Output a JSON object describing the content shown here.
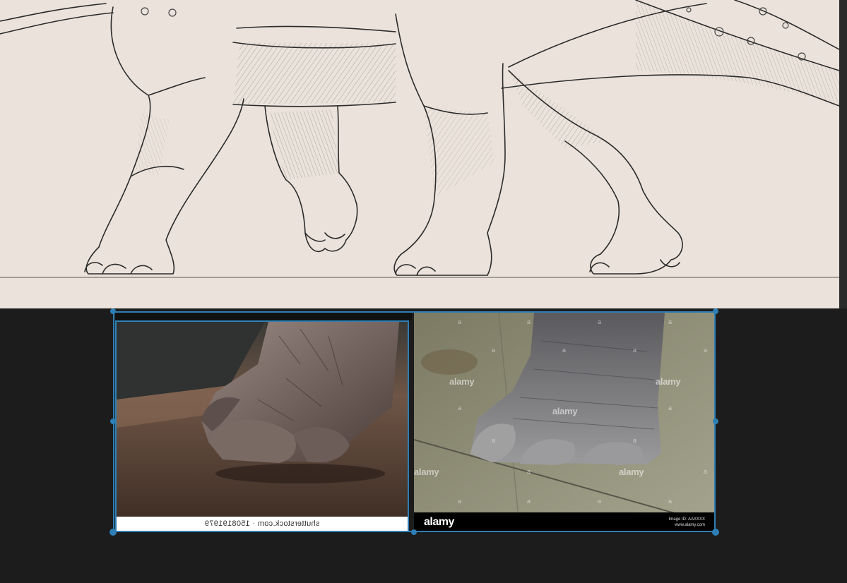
{
  "canvas": {
    "background": "#ebe3db",
    "subject": "pencil sketch of dinosaur legs and feet"
  },
  "references": {
    "left_photo": {
      "caption": "shutterstock.com · 1508191979",
      "caption_mirrored": true
    },
    "right_photo": {
      "logo": "alamy",
      "watermark": "alamy",
      "watermark_letter": "a",
      "meta_line1": "Image ID: AAXXXX",
      "meta_line2": "www.alamy.com"
    }
  },
  "selection": {
    "color": "#2d7fb5"
  }
}
